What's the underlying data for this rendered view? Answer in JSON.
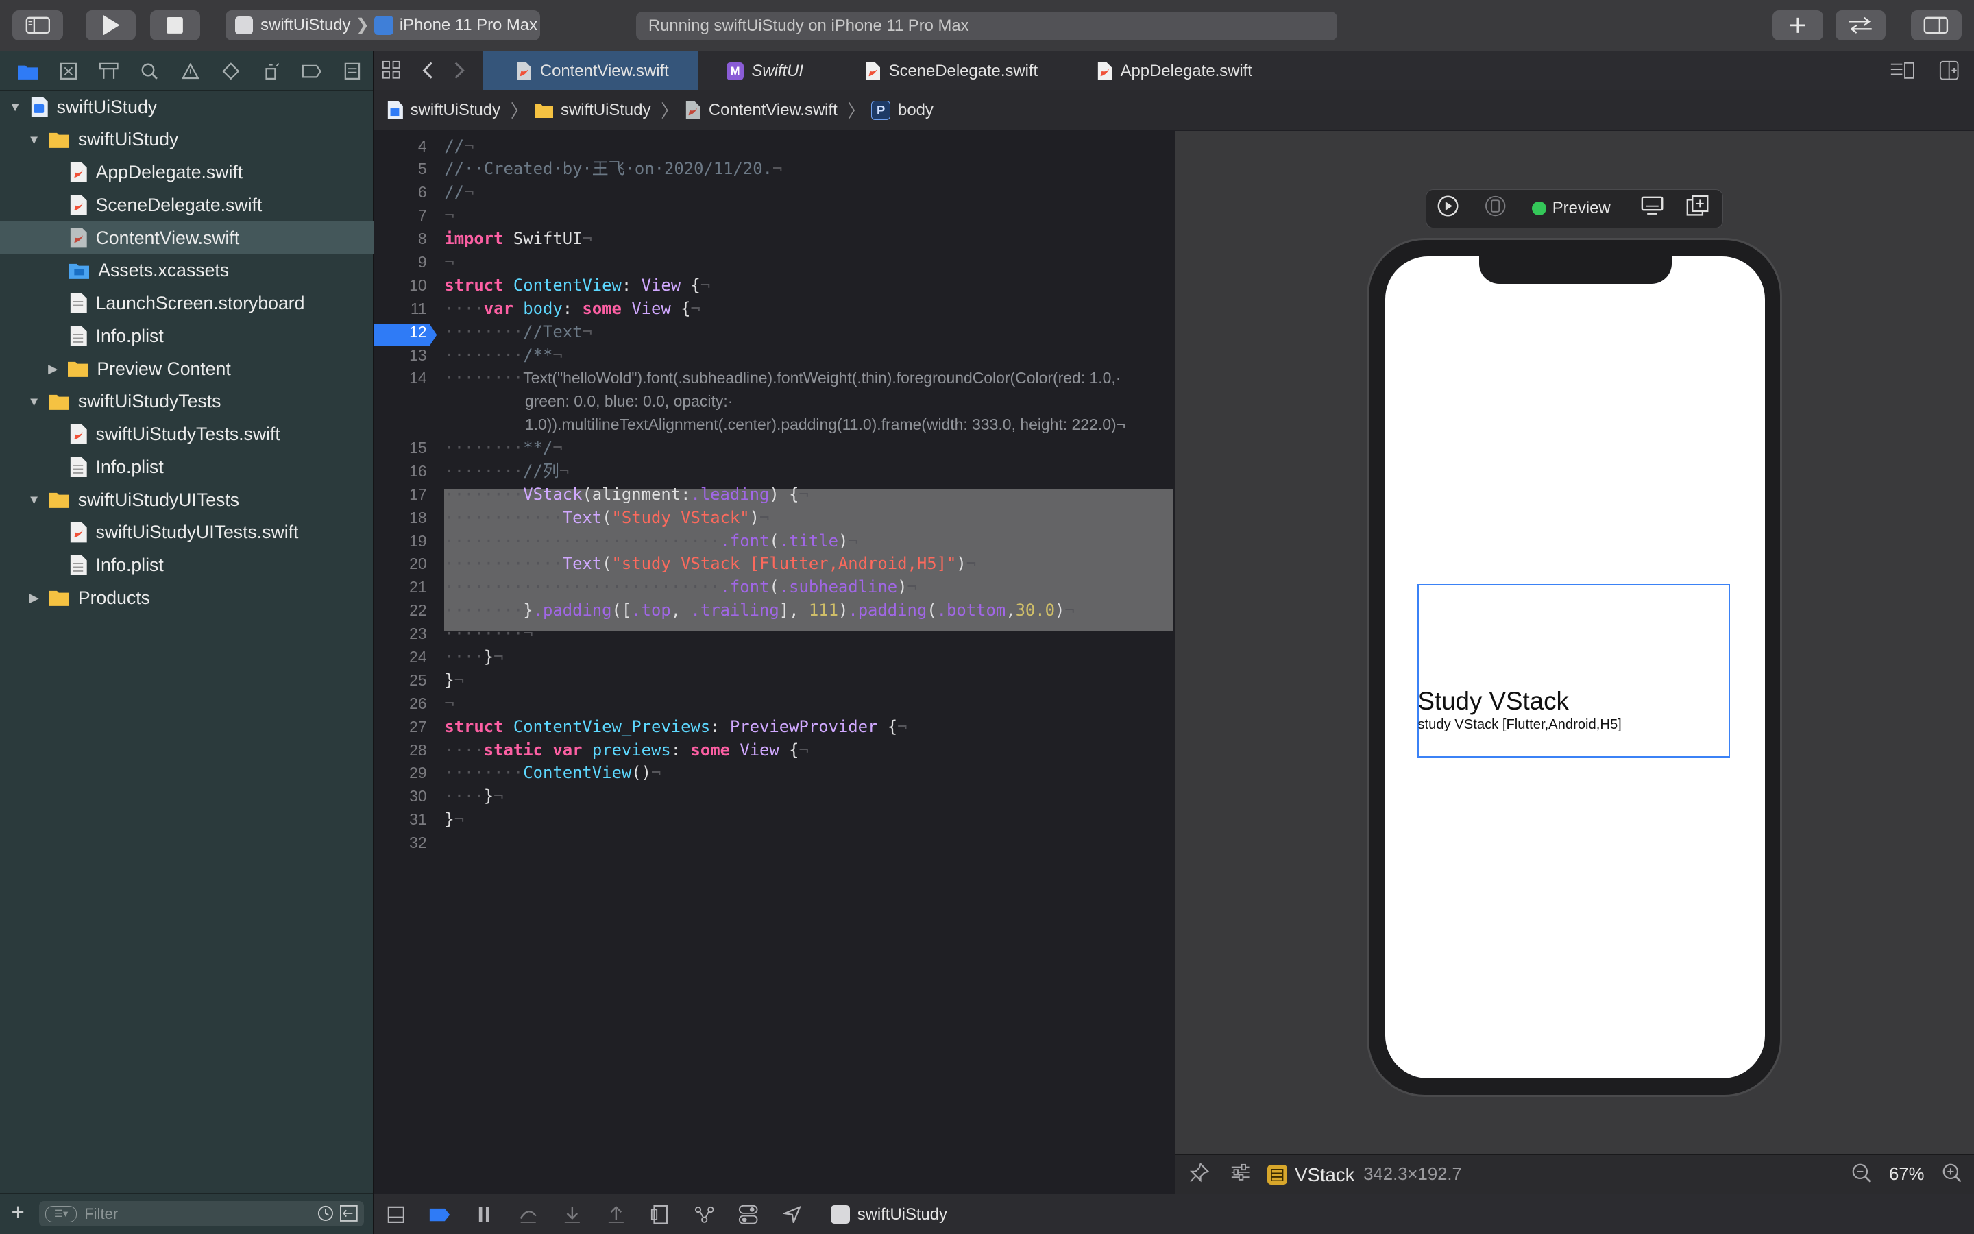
{
  "toolbar": {
    "scheme_name": "swiftUiStudy",
    "destination": "iPhone 11 Pro Max",
    "status": "Running swiftUiStudy on iPhone 11 Pro Max"
  },
  "navigator": {
    "tree": [
      {
        "label": "swiftUiStudy"
      },
      {
        "label": "swiftUiStudy"
      },
      {
        "label": "AppDelegate.swift"
      },
      {
        "label": "SceneDelegate.swift"
      },
      {
        "label": "ContentView.swift"
      },
      {
        "label": "Assets.xcassets"
      },
      {
        "label": "LaunchScreen.storyboard"
      },
      {
        "label": "Info.plist"
      },
      {
        "label": "Preview Content"
      },
      {
        "label": "swiftUiStudyTests"
      },
      {
        "label": "swiftUiStudyTests.swift"
      },
      {
        "label": "Info.plist"
      },
      {
        "label": "swiftUiStudyUITests"
      },
      {
        "label": "swiftUiStudyUITests.swift"
      },
      {
        "label": "Info.plist"
      },
      {
        "label": "Products"
      }
    ],
    "filter_placeholder": "Filter"
  },
  "tabs": [
    {
      "label": "ContentView.swift"
    },
    {
      "label": "SwiftUI"
    },
    {
      "label": "SceneDelegate.swift"
    },
    {
      "label": "AppDelegate.swift"
    }
  ],
  "breadcrumb": [
    "swiftUiStudy",
    "swiftUiStudy",
    "ContentView.swift",
    "body"
  ],
  "editor": {
    "current_line": 12,
    "lines": [
      {
        "n": "4",
        "text": "//¬"
      },
      {
        "n": "5",
        "text": "//··Created·by·王飞·on·2020/11/20.¬"
      },
      {
        "n": "6",
        "text": "//¬"
      },
      {
        "n": "7",
        "text": "¬"
      },
      {
        "n": "8",
        "text": "import SwiftUI¬"
      },
      {
        "n": "9",
        "text": "¬"
      },
      {
        "n": "10",
        "text": "struct ContentView: View {¬"
      },
      {
        "n": "11",
        "text": "····var body: some View {¬"
      },
      {
        "n": "12",
        "text": "········//Text¬"
      },
      {
        "n": "13",
        "text": "········/**¬"
      },
      {
        "n": "14",
        "text": "········Text(\"helloWold\").font(.subheadline).fontWeight(.thin).foregroundColor(Color(red: 1.0,·"
      },
      {
        "n": "",
        "text": "        green: 0.0, blue: 0.0, opacity:·"
      },
      {
        "n": "",
        "text": "        1.0)).multilineTextAlignment(.center).padding(11.0).frame(width: 333.0, height: 222.0)¬"
      },
      {
        "n": "15",
        "text": "········**/¬"
      },
      {
        "n": "16",
        "text": "········//列¬"
      },
      {
        "n": "17",
        "text": "········VStack(alignment:.leading) {¬"
      },
      {
        "n": "18",
        "text": "············Text(\"Study VStack\")¬"
      },
      {
        "n": "19",
        "text": "····························.font(.title)¬"
      },
      {
        "n": "20",
        "text": "············Text(\"study VStack [Flutter,Android,H5]\")¬"
      },
      {
        "n": "21",
        "text": "····························.font(.subheadline)¬"
      },
      {
        "n": "22",
        "text": "········}.padding([.top, .trailing], 111).padding(.bottom,30.0)¬"
      },
      {
        "n": "23",
        "text": "········¬"
      },
      {
        "n": "24",
        "text": "····}¬"
      },
      {
        "n": "25",
        "text": "}¬"
      },
      {
        "n": "26",
        "text": "¬"
      },
      {
        "n": "27",
        "text": "struct ContentView_Previews: PreviewProvider {¬"
      },
      {
        "n": "28",
        "text": "····static var previews: some View {¬"
      },
      {
        "n": "29",
        "text": "········ContentView()¬"
      },
      {
        "n": "30",
        "text": "····}¬"
      },
      {
        "n": "31",
        "text": "}¬"
      },
      {
        "n": "32",
        "text": ""
      }
    ]
  },
  "canvas": {
    "preview_label": "Preview",
    "preview_status_color": "#34c759",
    "preview_title": "Study VStack",
    "preview_subtitle": "study VStack [Flutter,Android,H5]",
    "selected_view": "VStack",
    "selected_size": "342.3×192.7",
    "zoom": "67%"
  },
  "debug": {
    "target": "swiftUiStudy"
  },
  "colors": {
    "accent": "#2f7bf6",
    "keyword": "#fc5fa3",
    "string": "#fc6a5d",
    "number": "#d0bf69",
    "type": "#5dd8ff"
  }
}
